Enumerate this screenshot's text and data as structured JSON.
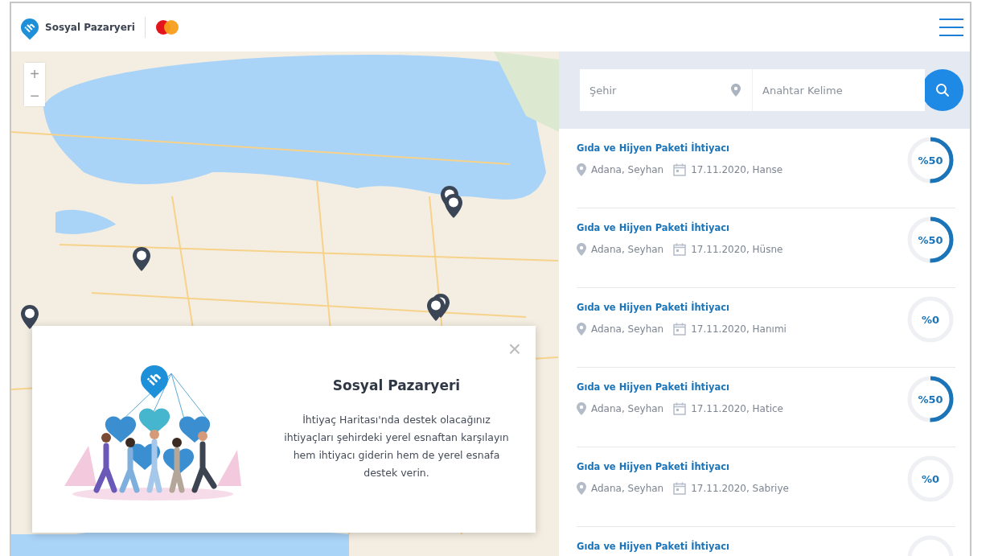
{
  "header": {
    "logo_mark": "ih",
    "brand": "Sosyal Pazaryeri"
  },
  "map": {
    "zoom_in": "+",
    "zoom_out": "−"
  },
  "popup": {
    "close": "×",
    "logo_mark": "ih",
    "title": "Sosyal Pazaryeri",
    "text": "İhtiyaç Haritası'nda destek olacağınız ihtiyaçları şehirdeki yerel esnaftan karşılayın hem ihtiyacı giderin hem de yerel esnafa destek verin."
  },
  "search": {
    "city_placeholder": "Şehir",
    "keyword_placeholder": "Anahtar Kelime"
  },
  "needs": [
    {
      "title": "Gıda ve Hijyen Paketi İhtiyacı",
      "location": "Adana, Seyhan",
      "date": "17.11.2020, Hanse",
      "percent": "%50",
      "level": 0.5
    },
    {
      "title": "Gıda ve Hijyen Paketi İhtiyacı",
      "location": "Adana, Seyhan",
      "date": "17.11.2020, Hüsne",
      "percent": "%50",
      "level": 0.5
    },
    {
      "title": "Gıda ve Hijyen Paketi İhtiyacı",
      "location": "Adana, Seyhan",
      "date": "17.11.2020, Hanımi",
      "percent": "%0",
      "level": 0
    },
    {
      "title": "Gıda ve Hijyen Paketi İhtiyacı",
      "location": "Adana, Seyhan",
      "date": "17.11.2020, Hatice",
      "percent": "%50",
      "level": 0.5
    },
    {
      "title": "Gıda ve Hijyen Paketi İhtiyacı",
      "location": "Adana, Seyhan",
      "date": "17.11.2020, Sabriye",
      "percent": "%0",
      "level": 0
    },
    {
      "title": "Gıda ve Hijyen Paketi İhtiyacı",
      "level": 0
    }
  ]
}
